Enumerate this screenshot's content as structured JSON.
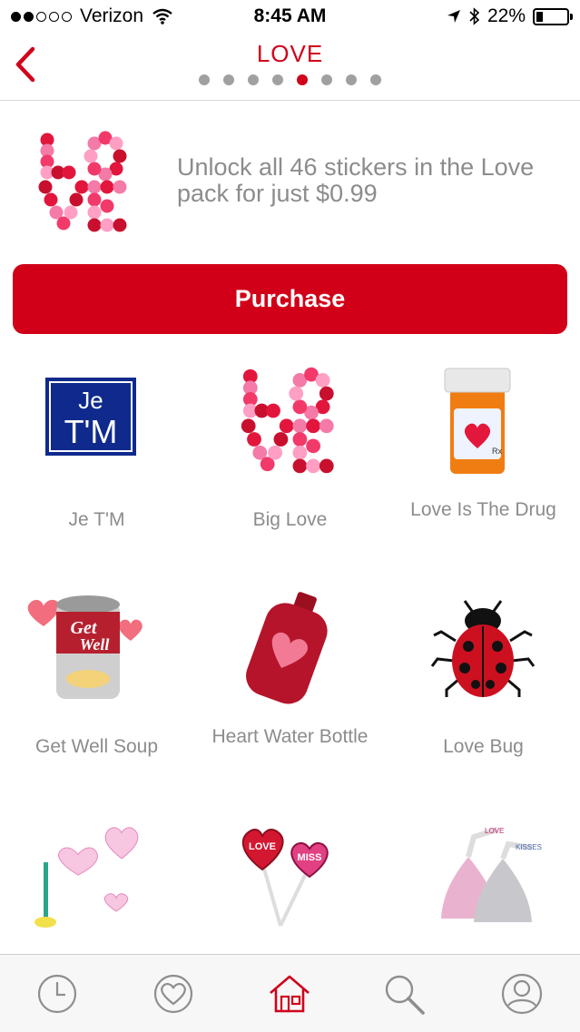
{
  "status_bar": {
    "carrier": "Verizon",
    "time": "8:45 AM",
    "battery": "22%",
    "battery_level": 0.22
  },
  "nav": {
    "title": "LOVE",
    "page_count": 8,
    "current_page_index": 4
  },
  "promo": {
    "text": "Unlock all 46 stickers in the Love pack for just $0.99",
    "purchase_label": "Purchase"
  },
  "stickers": [
    {
      "label": "Je T'M",
      "art_text": [
        "Je",
        "T'M"
      ]
    },
    {
      "label": "Big Love"
    },
    {
      "label": "Love Is The Drug"
    },
    {
      "label": "Get Well Soup",
      "art_text": [
        "Get",
        "Well"
      ]
    },
    {
      "label": "Heart Water Bottle"
    },
    {
      "label": "Love Bug"
    },
    {
      "label": ""
    },
    {
      "label": "",
      "art_text": [
        "LOVE",
        "MISS"
      ]
    },
    {
      "label": "",
      "art_text": [
        "LOVE",
        "KISSES"
      ]
    }
  ],
  "tabs": [
    {
      "name": "recent",
      "icon": "clock-icon"
    },
    {
      "name": "favorites",
      "icon": "heart-icon"
    },
    {
      "name": "home",
      "icon": "home-icon",
      "active": true
    },
    {
      "name": "search",
      "icon": "search-icon"
    },
    {
      "name": "profile",
      "icon": "profile-icon"
    }
  ],
  "colors": {
    "accent": "#d0021b",
    "purchase": "#d10018",
    "text_gray": "#8c8c8c",
    "tab_inactive": "#8e8e8e"
  }
}
